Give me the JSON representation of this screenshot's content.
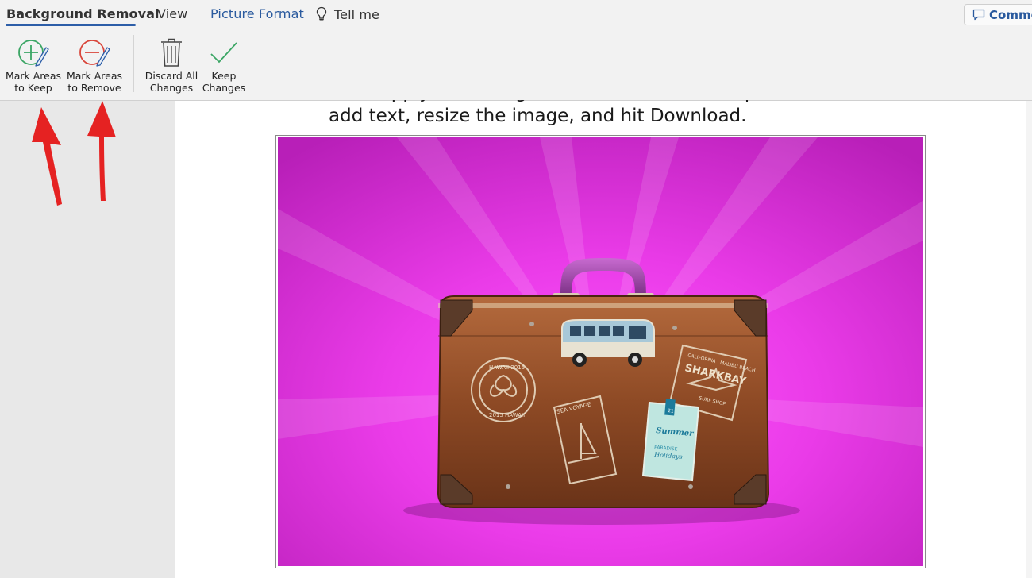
{
  "tabs": {
    "background_removal": "Background Removal",
    "view": "View",
    "picture_format": "Picture Format",
    "tell_me": "Tell me",
    "comments": "Comme"
  },
  "ribbon": {
    "mark_keep_line1": "Mark Areas",
    "mark_keep_line2": "to Keep",
    "mark_remove_line1": "Mark Areas",
    "mark_remove_line2": "to Remove",
    "discard_line1": "Discard All",
    "discard_line2": "Changes",
    "keep_line1": "Keep",
    "keep_line2": "Changes"
  },
  "document": {
    "line_partial": "Then apply the background, add more to the picture or text,",
    "line_main": "add text, resize the image, and hit Download."
  },
  "photo": {
    "bus_icon": "van-sticker",
    "stamp_hawaii_top": "HAWAII 2015",
    "stamp_hawaii_bottom": "2015 HAWAII",
    "stamp_sea": "SEA VOYAGE",
    "stamp_shark_top": "CALIFORNIA · MALIBU BEACH",
    "stamp_shark_main": "SHARKBAY",
    "stamp_shark_small": "SURF SHOP",
    "tag_summer": "Summer",
    "tag_paradise": "PARADISE",
    "tag_holidays": "Holidays",
    "tag_number": "21"
  },
  "colors": {
    "accent_blue": "#2d5ea8",
    "keep_green": "#3aa564",
    "remove_red": "#d9453a",
    "magenta_bg": "#e83de6",
    "arrow_red": "#e52222"
  }
}
